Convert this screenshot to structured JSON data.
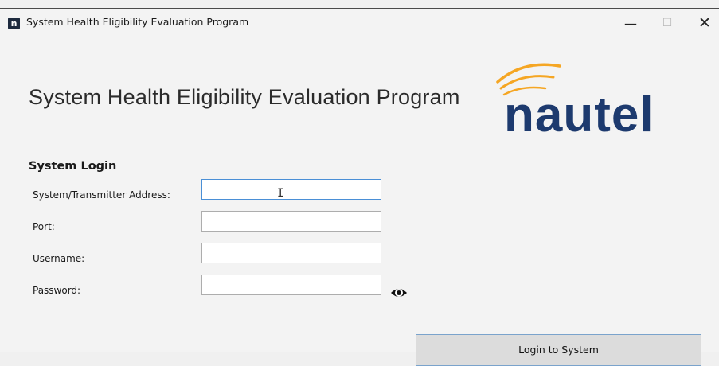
{
  "window": {
    "title": "System Health Eligibility Evaluation Program",
    "icon": "nautel-app-icon",
    "icon_glyph": "n",
    "controls": {
      "minimize": "—",
      "maximize": "☐",
      "close": "✕"
    }
  },
  "header": {
    "title": "System Health Eligibility Evaluation Program",
    "logo_text": "nautel",
    "logo_colors": {
      "text": "#1d3a6e",
      "arcs": "#f5a623"
    }
  },
  "login": {
    "section_title": "System Login",
    "fields": [
      {
        "label": "System/Transmitter Address:",
        "value": "",
        "focused": true
      },
      {
        "label": "Port:",
        "value": ""
      },
      {
        "label": "Username:",
        "value": ""
      },
      {
        "label": "Password:",
        "value": "",
        "icon": "eye-icon"
      }
    ],
    "submit_label": "Login to System"
  },
  "colors": {
    "focus_border": "#4a8fd6",
    "button_border": "#7aa3cc"
  }
}
